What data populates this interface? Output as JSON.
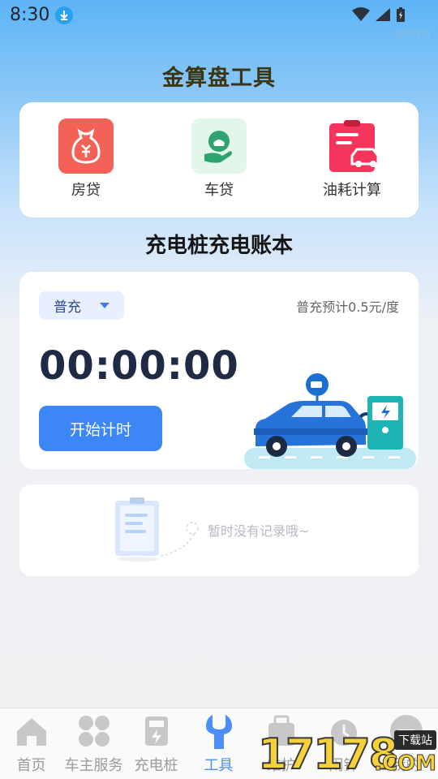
{
  "status_bar": {
    "time": "8:30",
    "build_code": "2537f523"
  },
  "page_title": "金算盘工具",
  "tools": [
    {
      "label": "房贷",
      "icon": "money-bag-yuan-icon",
      "color": "#f46257"
    },
    {
      "label": "车贷",
      "icon": "hand-car-icon",
      "color": "#2fa36f"
    },
    {
      "label": "油耗计算",
      "icon": "clipboard-car-icon",
      "color": "#f5355c"
    }
  ],
  "section_title": "充电桩充电账本",
  "timer_card": {
    "mode_selected": "普充",
    "price_note": "普充预计0.5元/度",
    "timer": "00:00:00",
    "start_label": "开始计时"
  },
  "records": {
    "empty_text": "暂时没有记录哦~"
  },
  "tabbar": [
    {
      "label": "首页",
      "icon": "home-icon",
      "active": false
    },
    {
      "label": "车主服务",
      "icon": "flower-icon",
      "active": false
    },
    {
      "label": "充电桩",
      "icon": "charger-icon",
      "active": false
    },
    {
      "label": "工具",
      "icon": "wrench-icon",
      "active": true
    },
    {
      "label": "维护",
      "icon": "maintenance-icon",
      "active": false
    },
    {
      "label": "闹钟",
      "icon": "alarm-icon",
      "active": false
    },
    {
      "label": "我的",
      "icon": "profile-icon",
      "active": false
    }
  ],
  "watermark": {
    "text": "17178",
    "badge": "下载站",
    "suffix": ".COM"
  },
  "colors": {
    "accent": "#3d86f5",
    "active_tab": "#4d8ef7"
  }
}
